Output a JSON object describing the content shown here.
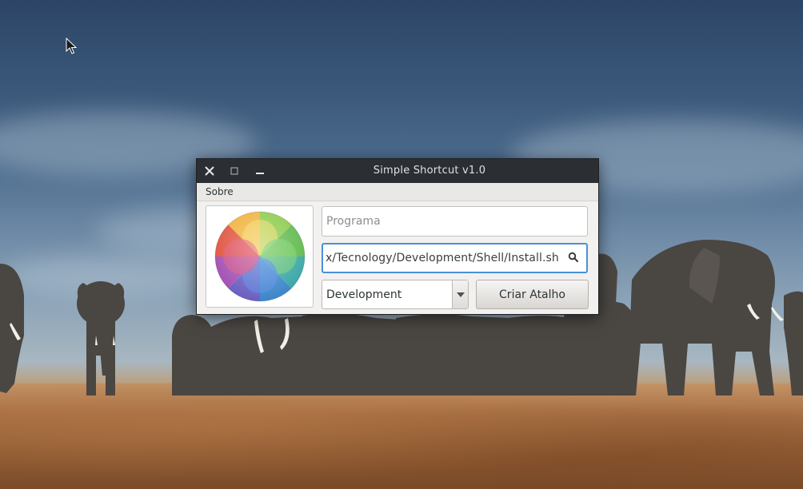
{
  "window": {
    "title": "Simple Shortcut v1.0"
  },
  "menubar": {
    "items": [
      {
        "label": "Sobre"
      }
    ]
  },
  "form": {
    "name_placeholder": "Programa",
    "path_value": "x/Tecnology/Development/Shell/Install.sh",
    "category_selected": "Development",
    "create_button_label": "Criar Atalho"
  },
  "icons": {
    "close": "close-icon",
    "maximize": "maximize-icon",
    "minimize": "minimize-icon",
    "search": "search-icon",
    "dropdown": "chevron-down-icon",
    "app_logo": "color-wheel-logo"
  },
  "colors": {
    "titlebar": "#2b2e33",
    "focus_border": "#4a90d9",
    "window_bg": "#f2f1f0"
  }
}
